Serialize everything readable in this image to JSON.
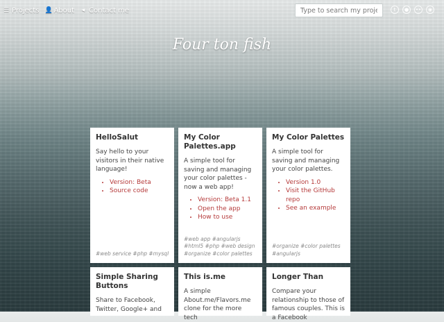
{
  "nav": {
    "items": [
      {
        "label": "Projects",
        "icon": "list-icon"
      },
      {
        "label": "About",
        "icon": "user-icon"
      },
      {
        "label": "Contact me",
        "icon": "send-icon"
      }
    ]
  },
  "search": {
    "placeholder": "Type to search my projects"
  },
  "social": [
    "twitter-icon",
    "github-icon",
    "flickr-icon",
    "rss-icon"
  ],
  "site_title": "Four ton fish",
  "cards": [
    {
      "title": "HelloSalut",
      "description": "Say hello to your visitors in their native language!",
      "links": [
        "Version: Beta",
        "Source code"
      ],
      "tags": "#web service #php #mysql"
    },
    {
      "title": "My Color Palettes.app",
      "description": "A simple tool for saving and managing your color palettes - now a web app!",
      "links": [
        "Version: Beta 1.1",
        "Open the app",
        "How to use"
      ],
      "tags": "#web app #angularjs #html5 #php #web design #organize #color palettes"
    },
    {
      "title": "My Color Palettes",
      "description": "A simple tool for saving and managing your color palettes.",
      "links": [
        "Version 1.0",
        "Visit the GitHub repo",
        "See an example"
      ],
      "tags": "#organize #color palettes #angularjs"
    },
    {
      "title": "Simple Sharing Buttons",
      "description": "Share to Facebook, Twitter, Google+ and"
    },
    {
      "title": "This is.me",
      "description": "A simple About.me/Flavors.me clone for the more tech"
    },
    {
      "title": "Longer Than",
      "description": "Compare your relationship to those of famous couples. This is a Facebook"
    }
  ],
  "colors": {
    "link": "#b53a3a",
    "card_bg": "#ffffff",
    "tag": "#8a8a8a"
  }
}
